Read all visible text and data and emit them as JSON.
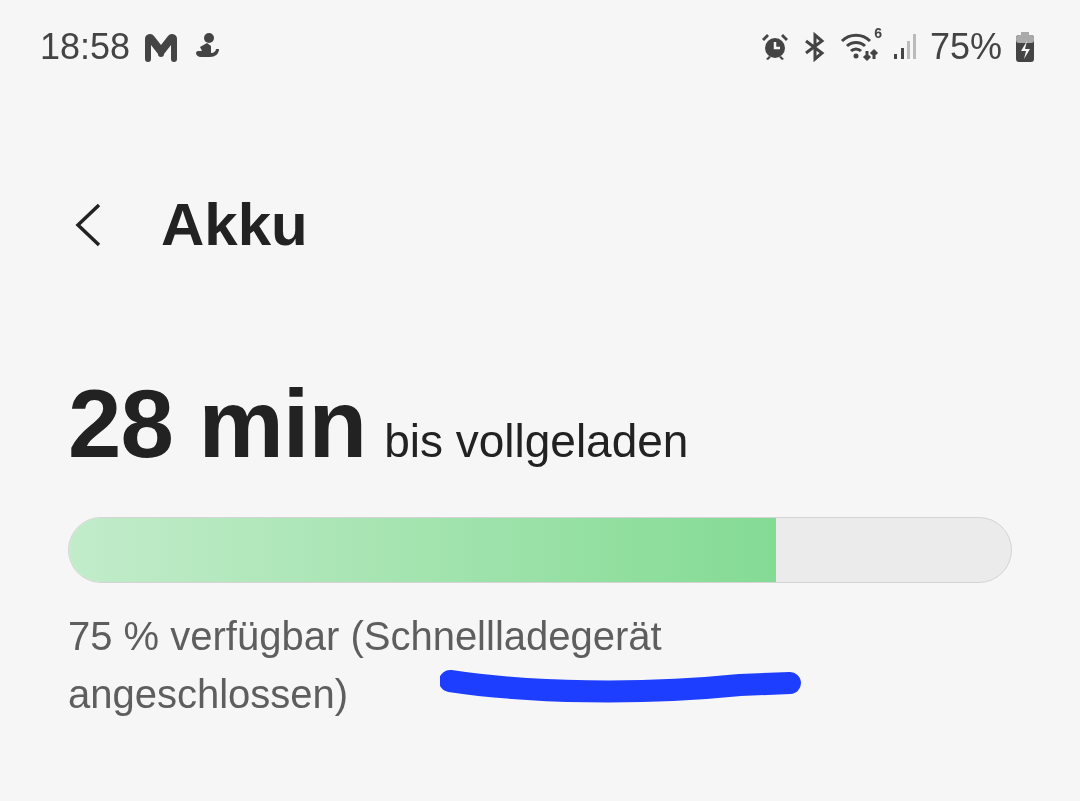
{
  "status_bar": {
    "time": "18:58",
    "wifi_badge": "6",
    "battery_percent": "75%",
    "charging": true
  },
  "header": {
    "title": "Akku"
  },
  "battery": {
    "time_value": "28 min",
    "time_suffix": "bis vollgeladen",
    "level": 0.75,
    "status_text": "75 % verfügbar (Schnellladegerät angeschlossen)"
  },
  "annotation_mark": {
    "color": "#1d3dff"
  }
}
